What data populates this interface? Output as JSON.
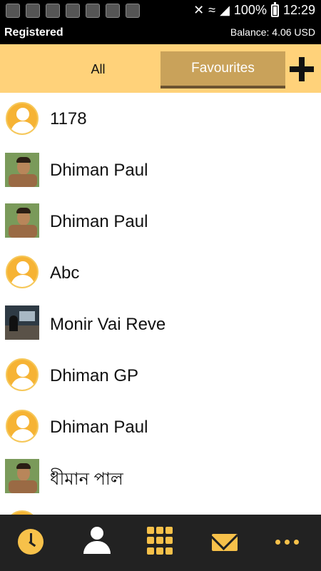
{
  "status_bar": {
    "battery": "100%",
    "time": "12:29",
    "icons": [
      "gallery-icon",
      "shield-icon",
      "app-icon",
      "shield-icon",
      "app-icon",
      "settings-icon",
      "app-icon"
    ],
    "signal_icons": [
      "mute-icon",
      "wifi-icon",
      "signal-icon",
      "battery-icon"
    ]
  },
  "account": {
    "status": "Registered",
    "balance": "Balance: 4.06 USD"
  },
  "tabs": {
    "all": "All",
    "favourites": "Favourites",
    "active": "favourites",
    "add_icon": "plus-icon"
  },
  "contacts": [
    {
      "name": "1178",
      "avatar": "default"
    },
    {
      "name": "Dhiman Paul",
      "avatar": "photo"
    },
    {
      "name": "Dhiman Paul",
      "avatar": "photo"
    },
    {
      "name": "Abc",
      "avatar": "default"
    },
    {
      "name": "Monir Vai Reve",
      "avatar": "photo"
    },
    {
      "name": "Dhiman GP",
      "avatar": "default"
    },
    {
      "name": "Dhiman Paul",
      "avatar": "default"
    },
    {
      "name": "ধীমান পাল",
      "avatar": "photo"
    }
  ],
  "bottom_nav": [
    {
      "icon": "recent-calls-icon",
      "active": true
    },
    {
      "icon": "contacts-icon",
      "active": false
    },
    {
      "icon": "dialpad-icon",
      "active": false
    },
    {
      "icon": "messages-icon",
      "active": false
    },
    {
      "icon": "more-icon",
      "active": false
    }
  ],
  "colors": {
    "accent": "#f7c14a",
    "tab_bar": "#ffd27a",
    "tab_active": "#c9a25a",
    "nav_bar": "#222222"
  }
}
